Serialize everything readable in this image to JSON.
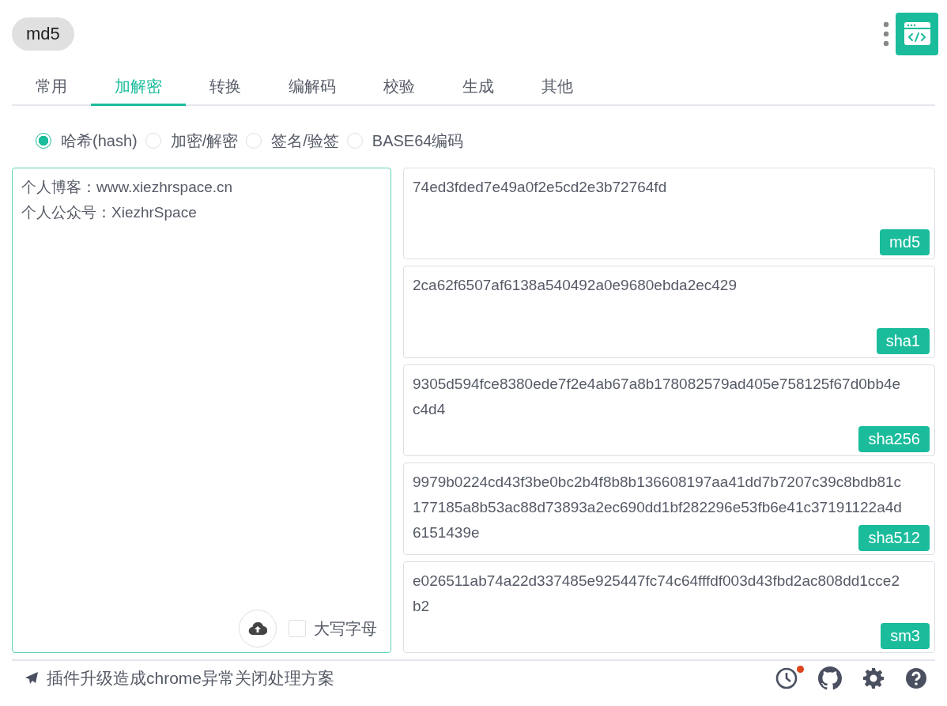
{
  "header": {
    "title": "md5"
  },
  "tabs": [
    {
      "label": "常用",
      "selected": false
    },
    {
      "label": "加解密",
      "selected": true
    },
    {
      "label": "转换",
      "selected": false
    },
    {
      "label": "编解码",
      "selected": false
    },
    {
      "label": "校验",
      "selected": false
    },
    {
      "label": "生成",
      "selected": false
    },
    {
      "label": "其他",
      "selected": false
    }
  ],
  "modes": [
    {
      "label": "哈希(hash)",
      "selected": true
    },
    {
      "label": "加密/解密",
      "selected": false
    },
    {
      "label": "签名/验签",
      "selected": false
    },
    {
      "label": "BASE64编码",
      "selected": false
    }
  ],
  "input": {
    "value": "个人博客：www.xiezhrspace.cn\n个人公众号：XiezhrSpace",
    "uppercase": {
      "label": "大写字母",
      "checked": false
    }
  },
  "outputs": [
    {
      "value": "74ed3fded7e49a0f2e5cd2e3b72764fd",
      "label": "md5"
    },
    {
      "value": "2ca62f6507af6138a540492a0e9680ebda2ec429",
      "label": "sha1"
    },
    {
      "value": "9305d594fce8380ede7f2e4ab67a8b178082579ad405e758125f67d0bb4ec4d4",
      "label": "sha256"
    },
    {
      "value": "9979b0224cd43f3be0bc2b4f8b8b136608197aa41dd7b7207c39c8bdb81c177185a8b53ac88d73893a2ec690dd1bf282296e53fb6e41c37191122a4d6151439e",
      "label": "sha512"
    },
    {
      "value": "e026511ab74a22d337485e925447fc74c64fffdf003d43fbd2ac808dd1cce2b2",
      "label": "sm3"
    }
  ],
  "footer": {
    "notice": "插件升级造成chrome异常关闭处理方案",
    "icons": [
      {
        "kind": "history",
        "badge": true
      },
      {
        "kind": "github",
        "badge": false
      },
      {
        "kind": "settings",
        "badge": false
      },
      {
        "kind": "help",
        "badge": false
      }
    ]
  }
}
